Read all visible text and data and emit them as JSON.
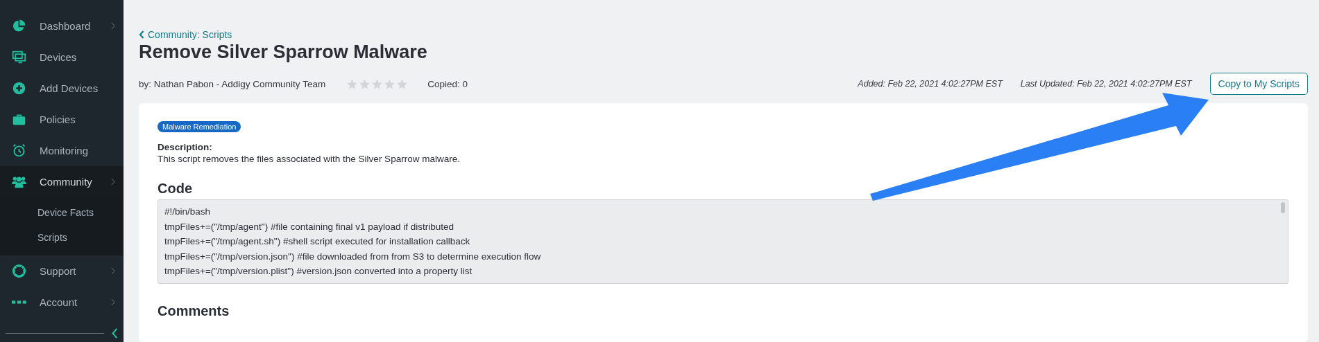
{
  "sidebar": {
    "items": [
      {
        "label": "Dashboard",
        "selected": false,
        "has_submenu": true
      },
      {
        "label": "Devices",
        "selected": false,
        "has_submenu": false
      },
      {
        "label": "Add Devices",
        "selected": false,
        "has_submenu": false
      },
      {
        "label": "Policies",
        "selected": false,
        "has_submenu": false
      },
      {
        "label": "Monitoring",
        "selected": false,
        "has_submenu": false
      },
      {
        "label": "Community",
        "selected": true,
        "has_submenu": true,
        "children": [
          {
            "label": "Device Facts"
          },
          {
            "label": "Scripts"
          }
        ]
      },
      {
        "label": "Support",
        "selected": false,
        "has_submenu": true
      },
      {
        "label": "Account",
        "selected": false,
        "has_submenu": true
      }
    ]
  },
  "breadcrumb": "Community: Scripts",
  "title": "Remove Silver Sparrow Malware",
  "author": "by: Nathan Pabon - Addigy Community Team",
  "rating": {
    "stars": 0
  },
  "copied": "Copied: 0",
  "added": "Added: Feb 22, 2021 4:02:27PM EST",
  "updated": "Last Updated: Feb 22, 2021 4:02:27PM EST",
  "copy_button": "Copy to My Scripts",
  "tag": "Malware Remediation",
  "description_label": "Description:",
  "description": "This script removes the files associated with the Silver Sparrow malware.",
  "code_heading": "Code",
  "code_lines": [
    "#!/bin/bash",
    "tmpFiles+=(\"/tmp/agent\") #file containing final v1 payload if distributed",
    "tmpFiles+=(\"/tmp/agent.sh\") #shell script executed for installation callback",
    "tmpFiles+=(\"/tmp/version.json\") #file downloaded from from S3 to determine execution flow",
    "tmpFiles+=(\"/tmp/version.plist\") #version.json converted into a property list"
  ],
  "comments_heading": "Comments"
}
